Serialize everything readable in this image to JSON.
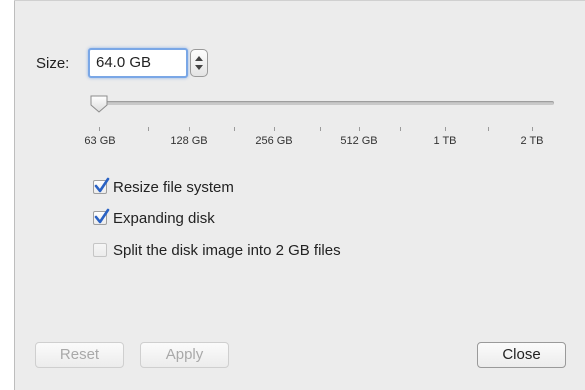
{
  "size": {
    "label": "Size:",
    "value": "64.0 GB"
  },
  "slider": {
    "ticks": [
      "63 GB",
      "128 GB",
      "256 GB",
      "512 GB",
      "1 TB",
      "2 TB"
    ],
    "selected_index": 0
  },
  "options": [
    {
      "label": "Resize file system",
      "checked": true,
      "enabled": true
    },
    {
      "label": "Expanding disk",
      "checked": true,
      "enabled": true
    },
    {
      "label": "Split the disk image into 2 GB files",
      "checked": false,
      "enabled": true
    }
  ],
  "buttons": {
    "reset": {
      "label": "Reset",
      "enabled": false
    },
    "apply": {
      "label": "Apply",
      "enabled": false
    },
    "close": {
      "label": "Close",
      "enabled": true
    }
  },
  "colors": {
    "focus_ring": "#7aa7e6",
    "checkmark": "#2a62c4"
  }
}
